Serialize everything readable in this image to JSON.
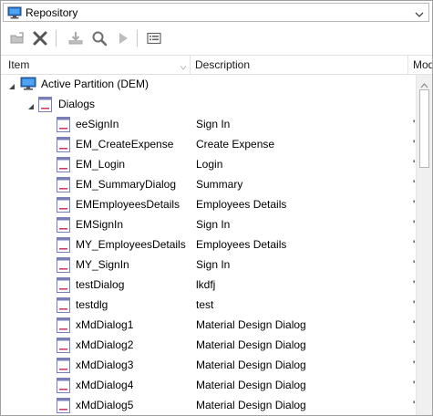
{
  "window": {
    "title": "Repository",
    "title_icon": "monitor-icon",
    "dropdown_icon": "chevron-down-icon"
  },
  "toolbar": {
    "buttons": [
      {
        "name": "open-folder-button",
        "icon": "folder-icon",
        "enabled": false
      },
      {
        "name": "delete-button",
        "icon": "close-icon",
        "enabled": true
      },
      {
        "name": "download-button",
        "icon": "download-icon",
        "enabled": false
      },
      {
        "name": "search-button",
        "icon": "search-icon",
        "enabled": true
      },
      {
        "name": "run-button",
        "icon": "play-icon",
        "enabled": false
      },
      {
        "name": "properties-button",
        "icon": "properties-icon",
        "enabled": true
      }
    ]
  },
  "columns": {
    "item": "Item",
    "description": "Description",
    "modified": "Mod"
  },
  "tree": {
    "root": {
      "label": "Active Partition (DEM)",
      "icon": "monitor-icon",
      "expanded": true
    },
    "group": {
      "label": "Dialogs",
      "icon": "dialog-icon",
      "expanded": true
    },
    "items": [
      {
        "name": "eeSignIn",
        "description": "Sign In",
        "mod": "'"
      },
      {
        "name": "EM_CreateExpense",
        "description": "Create Expense",
        "mod": "'"
      },
      {
        "name": "EM_Login",
        "description": "Login",
        "mod": "'"
      },
      {
        "name": "EM_SummaryDialog",
        "description": "Summary",
        "mod": "'"
      },
      {
        "name": "EMEmployeesDetails",
        "description": "Employees Details",
        "mod": "'"
      },
      {
        "name": "EMSignIn",
        "description": "Sign In",
        "mod": "'"
      },
      {
        "name": "MY_EmployeesDetails",
        "description": "Employees Details",
        "mod": "'"
      },
      {
        "name": "MY_SignIn",
        "description": "Sign In",
        "mod": "'"
      },
      {
        "name": "testDialog",
        "description": "lkdfj",
        "mod": "'"
      },
      {
        "name": "testdlg",
        "description": "test",
        "mod": "'"
      },
      {
        "name": "xMdDialog1",
        "description": "Material Design Dialog",
        "mod": "'"
      },
      {
        "name": "xMdDialog2",
        "description": "Material Design Dialog",
        "mod": "'"
      },
      {
        "name": "xMdDialog3",
        "description": "Material Design Dialog",
        "mod": "'"
      },
      {
        "name": "xMdDialog4",
        "description": "Material Design Dialog",
        "mod": "'"
      },
      {
        "name": "xMdDialog5",
        "description": "Material Design Dialog",
        "mod": "'"
      }
    ]
  },
  "colors": {
    "dialog_icon_border": "#7a7fb8",
    "dialog_icon_accent": "#d23a6a",
    "monitor_blue": "#1f6fd1"
  }
}
